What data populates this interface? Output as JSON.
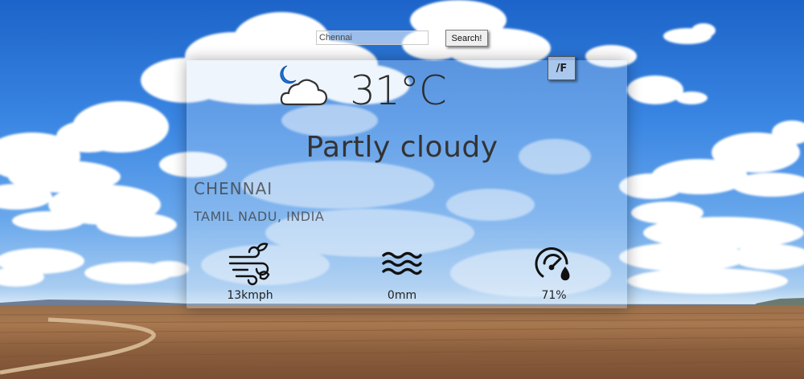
{
  "search": {
    "value": "Chennai",
    "button_label": "Search!"
  },
  "unit_toggle": {
    "label": "/F"
  },
  "current": {
    "icon": "partly-cloudy-night-icon",
    "temperature": "31°C",
    "condition": "Partly cloudy"
  },
  "location": {
    "city": "CHENNAI",
    "region": "TAMIL NADU, INDIA"
  },
  "stats": {
    "wind": {
      "icon": "wind-icon",
      "value": "13kmph"
    },
    "precipitation": {
      "icon": "water-waves-icon",
      "value": "0mm"
    },
    "humidity": {
      "icon": "humidity-gauge-icon",
      "value": "71%"
    }
  },
  "colors": {
    "sky": "#2f7ad9",
    "ground": "#9a6f4b",
    "text": "#2c2c2c",
    "moon": "#1f73d6"
  }
}
